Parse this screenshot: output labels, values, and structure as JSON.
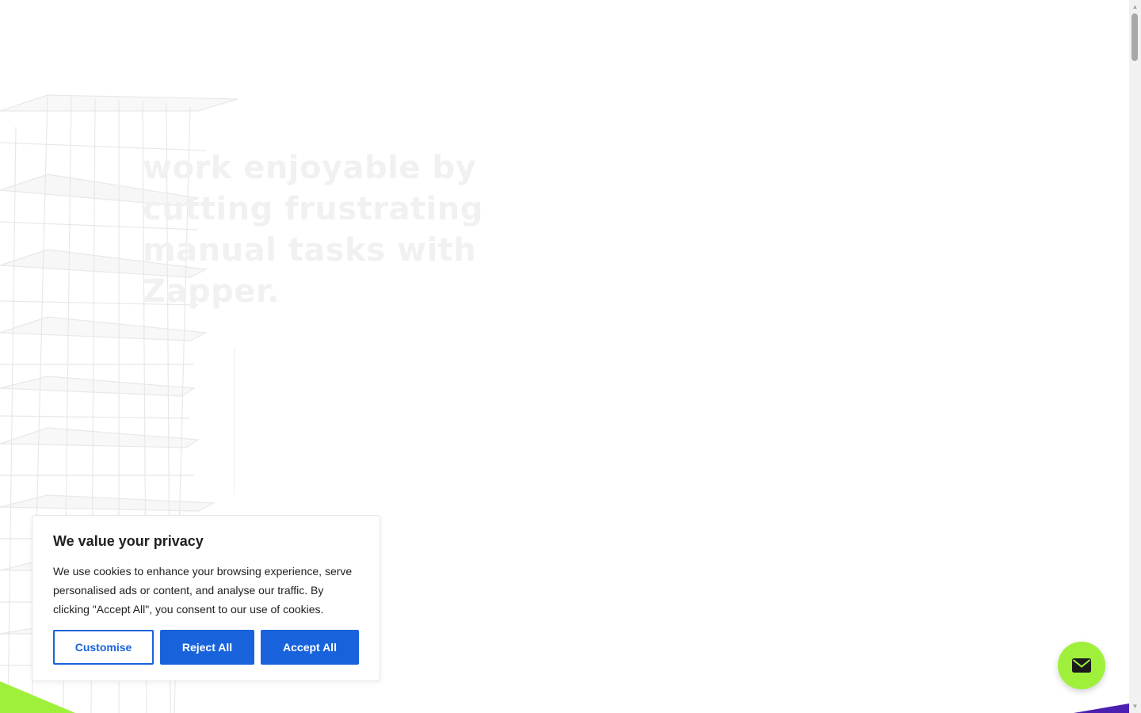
{
  "hero": {
    "headline": "work enjoyable by cutting frustrating manual tasks with Zapper."
  },
  "cookie_banner": {
    "title": "We value your privacy",
    "body": "We use cookies to enhance your browsing experience, serve personalised ads or content, and analyse our traffic. By clicking \"Accept All\", you consent to our use of cookies.",
    "customise_label": "Customise",
    "reject_label": "Reject All",
    "accept_label": "Accept All"
  },
  "floating_button": {
    "icon": "envelope-icon"
  },
  "colors": {
    "primary_blue": "#1863dc",
    "accent_green": "#9ff03b",
    "accent_purple": "#4b1fb0",
    "text_dark": "#212121"
  }
}
